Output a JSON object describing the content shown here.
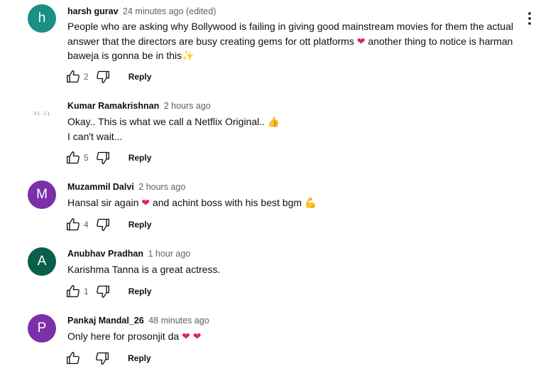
{
  "comments": [
    {
      "avatar_letter": "h",
      "avatar_color": "#1a8f84",
      "author": "harsh gurav",
      "time": "24 minutes ago (edited)",
      "text": "People who are asking why Bollywood is failing in giving good mainstream movies for them the actual answer that the directors are busy creating gems for ott platforms",
      "emoji_1": "❤",
      "text_2": "another thing to notice is harman baweja is gonna be in this",
      "emoji_2": "✨",
      "likes": "2",
      "reply_label": "Reply"
    },
    {
      "avatar_letter": "31-21",
      "avatar_color": "#ffffff",
      "author": "Kumar Ramakrishnan",
      "time": "2 hours ago",
      "text": "Okay.. This is what we call a Netflix Original..",
      "emoji_1": "👍",
      "text_2": "I can't wait...",
      "likes": "5",
      "reply_label": "Reply"
    },
    {
      "avatar_letter": "M",
      "avatar_color": "#7b2fa8",
      "author": "Muzammil Dalvi",
      "time": "2 hours ago",
      "text": "Hansal sir again",
      "emoji_1": "❤",
      "text_2": "and achint boss with his best bgm",
      "emoji_2": "💪",
      "likes": "4",
      "reply_label": "Reply"
    },
    {
      "avatar_letter": "A",
      "avatar_color": "#0b5e4a",
      "author": "Anubhav Pradhan",
      "time": "1 hour ago",
      "text": "Karishma Tanna is a great actress.",
      "likes": "1",
      "reply_label": "Reply"
    },
    {
      "avatar_letter": "P",
      "avatar_color": "#7b2fa8",
      "author": "Pankaj Mandal_26",
      "time": "48 minutes ago",
      "text": "Only here for prosonjit da",
      "emoji_1": "❤",
      "emoji_2": "❤",
      "likes": "",
      "reply_label": "Reply"
    }
  ],
  "icons": {
    "like": "thumb-up-icon",
    "dislike": "thumb-down-icon",
    "menu": "more-vert-icon"
  }
}
